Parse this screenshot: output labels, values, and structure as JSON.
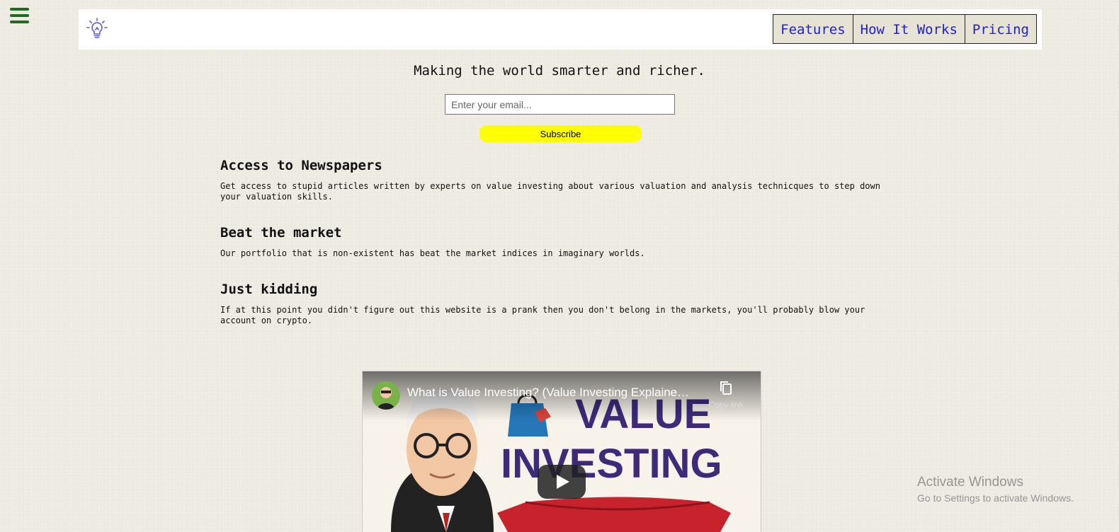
{
  "nav": {
    "links": [
      "Features",
      "How It Works",
      "Pricing"
    ]
  },
  "hero": {
    "tagline": "Making the world smarter and richer.",
    "email_placeholder": "Enter your email...",
    "subscribe_label": "Subscribe"
  },
  "features": [
    {
      "title": "Access to Newspapers",
      "description": "Get access to stupid articles written by experts on value investing about various valuation and analysis technicques to step down your valuation skills."
    },
    {
      "title": "Beat the market",
      "description": "Our portfolio that is non-existent has beat the market indices in imaginary worlds."
    },
    {
      "title": "Just kidding",
      "description": "If at this point you didn't figure out this website is a prank then you don't belong in the markets, you'll probably blow your account on crypto."
    }
  ],
  "video": {
    "title": "What is Value Investing? (Value Investing Explained in One Minute)",
    "copy_link_label": "Copy link",
    "thumbnail_text_line1": "VALUE",
    "thumbnail_text_line2": "INVESTING"
  },
  "watermark": {
    "title": "Activate Windows",
    "subtitle": "Go to Settings to activate Windows."
  },
  "colors": {
    "nav_link_text": "#1f1fcf",
    "subscribe_bg": "#ffff00",
    "hamburger": "#1d6b1d",
    "logo": "#5a5adb"
  }
}
